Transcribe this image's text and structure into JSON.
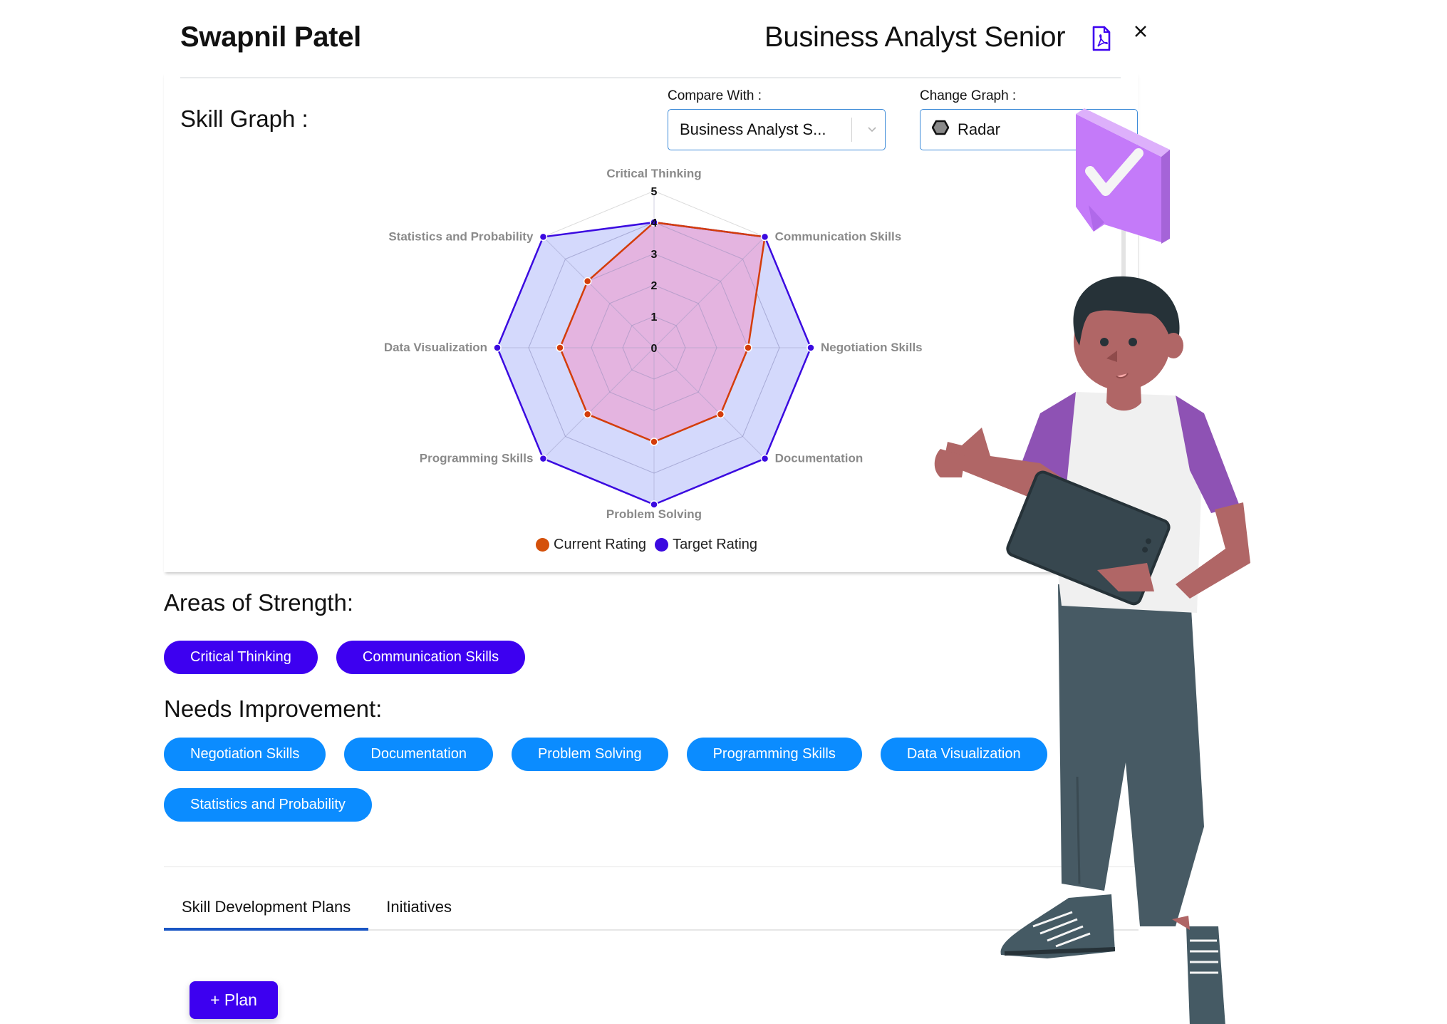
{
  "header": {
    "employee_name": "Swapnil Patel",
    "role_title": "Business Analyst Senior",
    "pdf_icon": "pdf-file-icon",
    "close_icon": "close-icon"
  },
  "skill_graph": {
    "title": "Skill Graph :",
    "compare_with": {
      "label": "Compare With :",
      "selected": "Business Analyst S...",
      "chevron_icon": "chevron-down-icon"
    },
    "change_graph": {
      "label": "Change Graph :",
      "selected": "Radar",
      "icon": "hexagon-radar-icon"
    }
  },
  "chart_data": {
    "type": "radar",
    "title": "",
    "categories": [
      "Critical Thinking",
      "Communication Skills",
      "Negotiation Skills",
      "Documentation",
      "Problem Solving",
      "Programming Skills",
      "Data Visualization",
      "Statistics and Probability"
    ],
    "series": [
      {
        "name": "Current Rating",
        "values": [
          4,
          5,
          3,
          3,
          3,
          3,
          3,
          3
        ],
        "color": "#d43d0a",
        "fill": "rgba(240,150,200,0.55)"
      },
      {
        "name": "Target Rating",
        "values": [
          4,
          5,
          5,
          5,
          5,
          5,
          5,
          5
        ],
        "color": "#3b0ae0",
        "fill": "rgba(170,180,250,0.5)"
      }
    ],
    "r_ticks": [
      "0",
      "1",
      "2",
      "3",
      "4",
      "5"
    ],
    "r_range": [
      0,
      5
    ],
    "grid": true,
    "legend_position": "bottom"
  },
  "areas_of_strength": {
    "title": "Areas of Strength:",
    "items": [
      "Critical Thinking",
      "Communication Skills"
    ]
  },
  "needs_improvement": {
    "title": "Needs Improvement:",
    "items": [
      "Negotiation Skills",
      "Documentation",
      "Problem Solving",
      "Programming Skills",
      "Data Visualization",
      "Statistics and Probability"
    ]
  },
  "tabs": [
    {
      "label": "Skill Development Plans",
      "active": true
    },
    {
      "label": "Initiatives",
      "active": false
    }
  ],
  "plan_button": {
    "label": "+ Plan"
  },
  "colors": {
    "primary": "#3d00f0",
    "improve_chip": "#0b8cff",
    "tab_underline": "#1a56c4",
    "select_border": "#3d8bd8"
  },
  "illustration": {
    "description": "man-with-tablet-thumbs-up",
    "badge_icon": "checkmark-badge-icon"
  }
}
